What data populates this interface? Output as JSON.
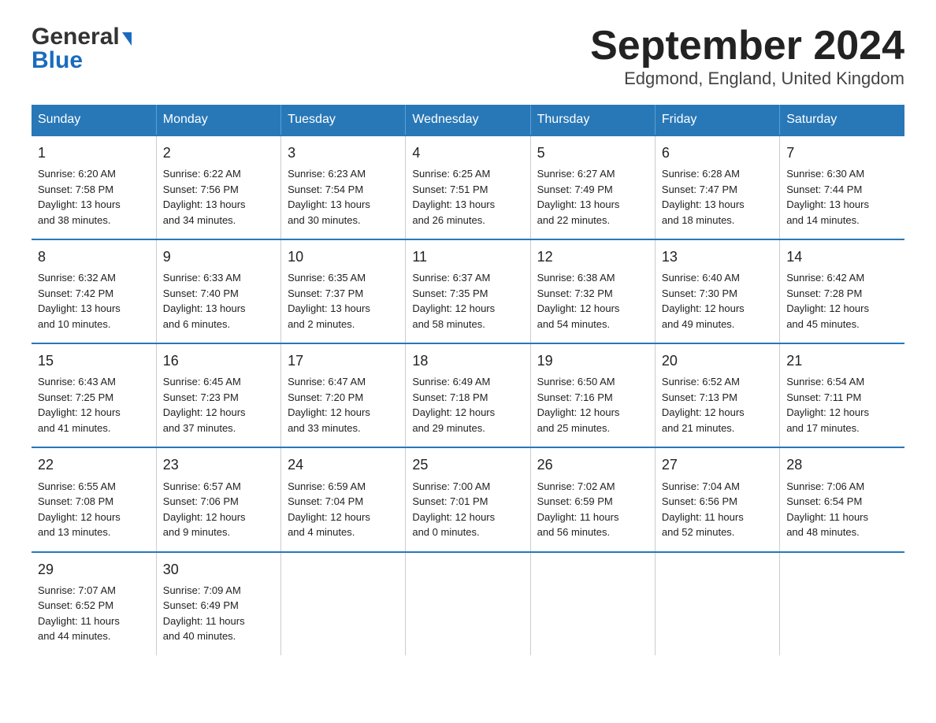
{
  "logo": {
    "general": "General",
    "triangle": "▶",
    "blue": "Blue"
  },
  "title": "September 2024",
  "subtitle": "Edgmond, England, United Kingdom",
  "headers": [
    "Sunday",
    "Monday",
    "Tuesday",
    "Wednesday",
    "Thursday",
    "Friday",
    "Saturday"
  ],
  "weeks": [
    [
      {
        "day": "1",
        "info": "Sunrise: 6:20 AM\nSunset: 7:58 PM\nDaylight: 13 hours\nand 38 minutes."
      },
      {
        "day": "2",
        "info": "Sunrise: 6:22 AM\nSunset: 7:56 PM\nDaylight: 13 hours\nand 34 minutes."
      },
      {
        "day": "3",
        "info": "Sunrise: 6:23 AM\nSunset: 7:54 PM\nDaylight: 13 hours\nand 30 minutes."
      },
      {
        "day": "4",
        "info": "Sunrise: 6:25 AM\nSunset: 7:51 PM\nDaylight: 13 hours\nand 26 minutes."
      },
      {
        "day": "5",
        "info": "Sunrise: 6:27 AM\nSunset: 7:49 PM\nDaylight: 13 hours\nand 22 minutes."
      },
      {
        "day": "6",
        "info": "Sunrise: 6:28 AM\nSunset: 7:47 PM\nDaylight: 13 hours\nand 18 minutes."
      },
      {
        "day": "7",
        "info": "Sunrise: 6:30 AM\nSunset: 7:44 PM\nDaylight: 13 hours\nand 14 minutes."
      }
    ],
    [
      {
        "day": "8",
        "info": "Sunrise: 6:32 AM\nSunset: 7:42 PM\nDaylight: 13 hours\nand 10 minutes."
      },
      {
        "day": "9",
        "info": "Sunrise: 6:33 AM\nSunset: 7:40 PM\nDaylight: 13 hours\nand 6 minutes."
      },
      {
        "day": "10",
        "info": "Sunrise: 6:35 AM\nSunset: 7:37 PM\nDaylight: 13 hours\nand 2 minutes."
      },
      {
        "day": "11",
        "info": "Sunrise: 6:37 AM\nSunset: 7:35 PM\nDaylight: 12 hours\nand 58 minutes."
      },
      {
        "day": "12",
        "info": "Sunrise: 6:38 AM\nSunset: 7:32 PM\nDaylight: 12 hours\nand 54 minutes."
      },
      {
        "day": "13",
        "info": "Sunrise: 6:40 AM\nSunset: 7:30 PM\nDaylight: 12 hours\nand 49 minutes."
      },
      {
        "day": "14",
        "info": "Sunrise: 6:42 AM\nSunset: 7:28 PM\nDaylight: 12 hours\nand 45 minutes."
      }
    ],
    [
      {
        "day": "15",
        "info": "Sunrise: 6:43 AM\nSunset: 7:25 PM\nDaylight: 12 hours\nand 41 minutes."
      },
      {
        "day": "16",
        "info": "Sunrise: 6:45 AM\nSunset: 7:23 PM\nDaylight: 12 hours\nand 37 minutes."
      },
      {
        "day": "17",
        "info": "Sunrise: 6:47 AM\nSunset: 7:20 PM\nDaylight: 12 hours\nand 33 minutes."
      },
      {
        "day": "18",
        "info": "Sunrise: 6:49 AM\nSunset: 7:18 PM\nDaylight: 12 hours\nand 29 minutes."
      },
      {
        "day": "19",
        "info": "Sunrise: 6:50 AM\nSunset: 7:16 PM\nDaylight: 12 hours\nand 25 minutes."
      },
      {
        "day": "20",
        "info": "Sunrise: 6:52 AM\nSunset: 7:13 PM\nDaylight: 12 hours\nand 21 minutes."
      },
      {
        "day": "21",
        "info": "Sunrise: 6:54 AM\nSunset: 7:11 PM\nDaylight: 12 hours\nand 17 minutes."
      }
    ],
    [
      {
        "day": "22",
        "info": "Sunrise: 6:55 AM\nSunset: 7:08 PM\nDaylight: 12 hours\nand 13 minutes."
      },
      {
        "day": "23",
        "info": "Sunrise: 6:57 AM\nSunset: 7:06 PM\nDaylight: 12 hours\nand 9 minutes."
      },
      {
        "day": "24",
        "info": "Sunrise: 6:59 AM\nSunset: 7:04 PM\nDaylight: 12 hours\nand 4 minutes."
      },
      {
        "day": "25",
        "info": "Sunrise: 7:00 AM\nSunset: 7:01 PM\nDaylight: 12 hours\nand 0 minutes."
      },
      {
        "day": "26",
        "info": "Sunrise: 7:02 AM\nSunset: 6:59 PM\nDaylight: 11 hours\nand 56 minutes."
      },
      {
        "day": "27",
        "info": "Sunrise: 7:04 AM\nSunset: 6:56 PM\nDaylight: 11 hours\nand 52 minutes."
      },
      {
        "day": "28",
        "info": "Sunrise: 7:06 AM\nSunset: 6:54 PM\nDaylight: 11 hours\nand 48 minutes."
      }
    ],
    [
      {
        "day": "29",
        "info": "Sunrise: 7:07 AM\nSunset: 6:52 PM\nDaylight: 11 hours\nand 44 minutes."
      },
      {
        "day": "30",
        "info": "Sunrise: 7:09 AM\nSunset: 6:49 PM\nDaylight: 11 hours\nand 40 minutes."
      },
      {
        "day": "",
        "info": ""
      },
      {
        "day": "",
        "info": ""
      },
      {
        "day": "",
        "info": ""
      },
      {
        "day": "",
        "info": ""
      },
      {
        "day": "",
        "info": ""
      }
    ]
  ]
}
